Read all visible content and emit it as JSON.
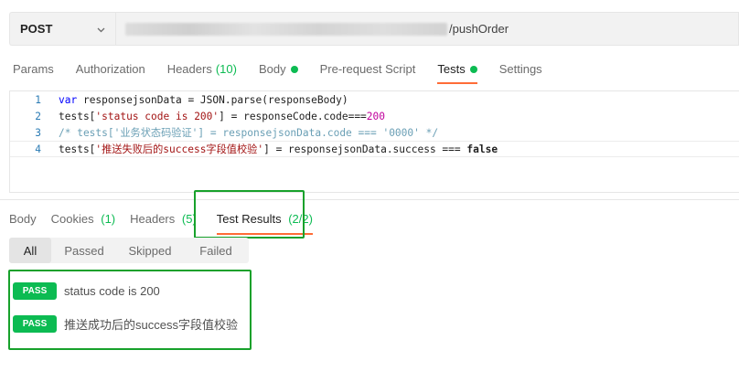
{
  "request": {
    "method": "POST",
    "url_suffix": "/pushOrder"
  },
  "request_tabs": [
    {
      "label": "Params"
    },
    {
      "label": "Authorization"
    },
    {
      "label": "Headers",
      "count": "(10)"
    },
    {
      "label": "Body"
    },
    {
      "label": "Pre-request Script"
    },
    {
      "label": "Tests"
    },
    {
      "label": "Settings"
    }
  ],
  "editor": {
    "line_numbers": [
      "1",
      "2",
      "3",
      "4"
    ],
    "line1": {
      "kw": "var",
      "rest": " responsejsonData = JSON.parse(responseBody)"
    },
    "line2": {
      "a": "tests[",
      "str": "'status code is 200'",
      "b": "] = responseCode.code===",
      "num": "200"
    },
    "line3": {
      "comment": "/* tests['业务状态码验证'] = responsejsonData.code === '0000' */"
    },
    "line4": {
      "a": "tests[",
      "str": "'推送失败后的success字段值校验'",
      "b": "] = responsejsonData.success === ",
      "kw": "false"
    }
  },
  "response_tabs": [
    {
      "label": "Body"
    },
    {
      "label": "Cookies",
      "count": "(1)"
    },
    {
      "label": "Headers",
      "count": "(5)"
    },
    {
      "label": "Test Results",
      "count": "(2/2)"
    }
  ],
  "filters": [
    "All",
    "Passed",
    "Skipped",
    "Failed"
  ],
  "results": [
    {
      "status": "PASS",
      "name": "status code is 200"
    },
    {
      "status": "PASS",
      "name": "推送成功后的success字段值校验"
    }
  ],
  "colors": {
    "accent": "#ff6c37",
    "pass": "#0cbb52",
    "highlight": "#17a12b"
  }
}
